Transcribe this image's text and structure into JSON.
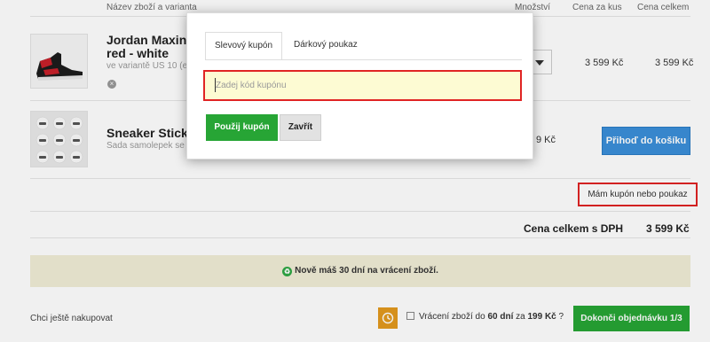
{
  "columns": {
    "product": "Název zboží a varianta",
    "quantity": "Množství",
    "unit_price": "Cena za kus",
    "total_price": "Cena celkem"
  },
  "items": [
    {
      "name_line1": "Jordan Maxin 2",
      "name_line2": "red - white",
      "variant": "ve variantě US 10 (e",
      "unit_price": "3 599 Kč",
      "total_price": "3 599 Kč"
    },
    {
      "name_line1": "Sneaker Sticke",
      "variant": "Sada samolepek se",
      "unit_price": "9 Kč",
      "add_button": "Přihoď do košíku"
    }
  ],
  "coupon_link": "Mám kupón nebo poukaz",
  "total": {
    "label": "Cena celkem s DPH",
    "value": "3 599 Kč"
  },
  "banner": {
    "text": "Nově máš 30 dní na vrácení zboží."
  },
  "footer": {
    "continue": "Chci ještě nakupovat",
    "return_prefix": "Vrácení zboží do ",
    "return_days": "60 dní",
    "return_mid": " za ",
    "return_price": "199 Kč",
    "return_help": " ?",
    "checkout": "Dokonči objednávku 1/3"
  },
  "modal": {
    "tabs": [
      "Slevový kupón",
      "Dárkový poukaz"
    ],
    "active_tab": 0,
    "input_placeholder": "Zadej kód kupónu",
    "input_value": "",
    "apply_button": "Použij kupón",
    "close_button": "Zavřít"
  },
  "colors": {
    "green": "#27a535",
    "blue": "#3b8fd9",
    "highlight_red": "#e02424",
    "banner_bg": "#f1edd6",
    "input_bg": "#fdfbd3"
  },
  "icons": {
    "remove": "remove-item-icon",
    "recycle": "recycle-icon",
    "history": "history-clock-icon",
    "dropdown": "chevron-down-icon"
  }
}
